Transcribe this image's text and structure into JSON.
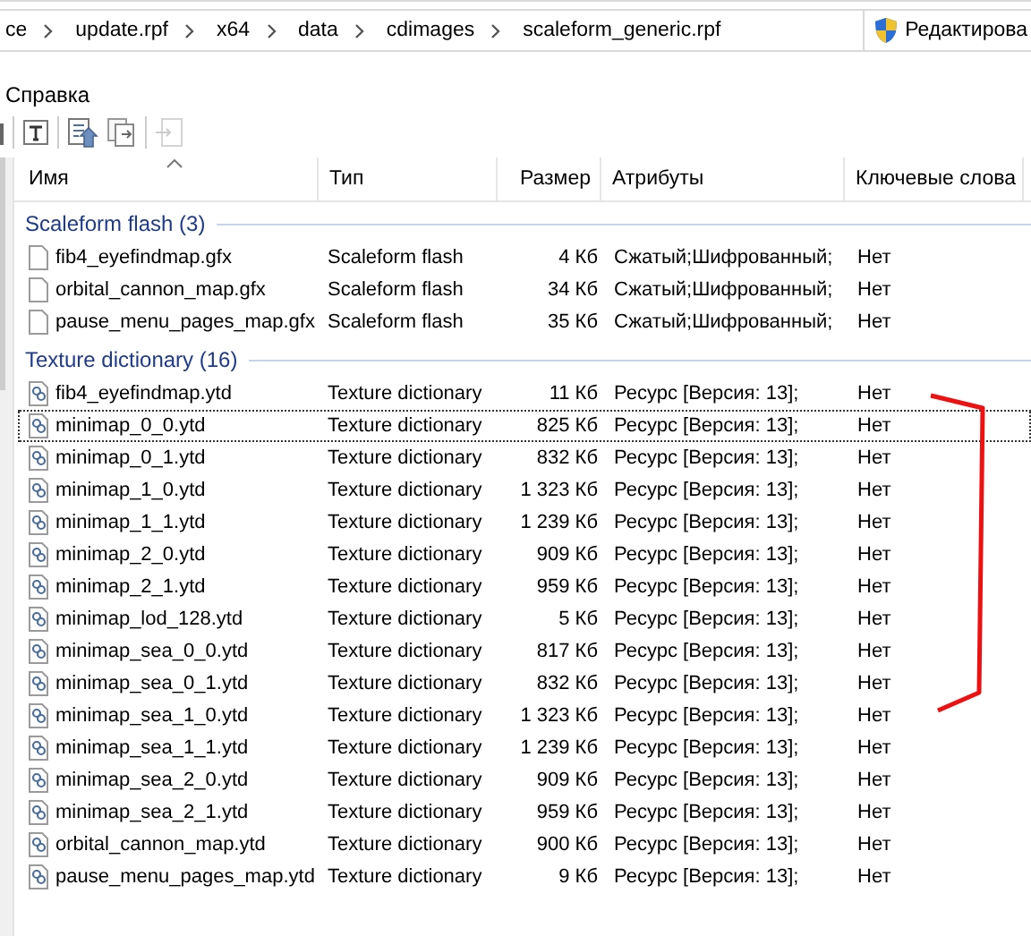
{
  "address_bar": {
    "segments": [
      "ce",
      "update.rpf",
      "x64",
      "data",
      "cdimages",
      "scaleform_generic.rpf"
    ],
    "action_button": "Редактирова"
  },
  "menu_bar": {
    "items": [
      "Справка"
    ]
  },
  "file_list": {
    "columns": [
      {
        "label": "Имя",
        "sorted": true
      },
      {
        "label": "Тип",
        "sorted": false
      },
      {
        "label": "Размер",
        "sorted": false
      },
      {
        "label": "Атрибуты",
        "sorted": false
      },
      {
        "label": "Ключевые слова",
        "sorted": false
      }
    ],
    "groups": [
      {
        "title": "Scaleform flash (3)",
        "kind": "flash",
        "rows": [
          {
            "name": "fib4_eyefindmap.gfx",
            "type": "Scaleform flash",
            "size": "4 Кб",
            "attributes": "Сжатый;Шифрованный;",
            "keywords": "Нет",
            "focused": false
          },
          {
            "name": "orbital_cannon_map.gfx",
            "type": "Scaleform flash",
            "size": "34 Кб",
            "attributes": "Сжатый;Шифрованный;",
            "keywords": "Нет",
            "focused": false
          },
          {
            "name": "pause_menu_pages_map.gfx",
            "type": "Scaleform flash",
            "size": "35 Кб",
            "attributes": "Сжатый;Шифрованный;",
            "keywords": "Нет",
            "focused": false
          }
        ]
      },
      {
        "title": "Texture dictionary (16)",
        "kind": "texture",
        "rows": [
          {
            "name": "fib4_eyefindmap.ytd",
            "type": "Texture dictionary",
            "size": "11 Кб",
            "attributes": "Ресурс [Версия: 13];",
            "keywords": "Нет",
            "focused": false
          },
          {
            "name": "minimap_0_0.ytd",
            "type": "Texture dictionary",
            "size": "825 Кб",
            "attributes": "Ресурс [Версия: 13];",
            "keywords": "Нет",
            "focused": true
          },
          {
            "name": "minimap_0_1.ytd",
            "type": "Texture dictionary",
            "size": "832 Кб",
            "attributes": "Ресурс [Версия: 13];",
            "keywords": "Нет",
            "focused": false
          },
          {
            "name": "minimap_1_0.ytd",
            "type": "Texture dictionary",
            "size": "1 323 Кб",
            "attributes": "Ресурс [Версия: 13];",
            "keywords": "Нет",
            "focused": false
          },
          {
            "name": "minimap_1_1.ytd",
            "type": "Texture dictionary",
            "size": "1 239 Кб",
            "attributes": "Ресурс [Версия: 13];",
            "keywords": "Нет",
            "focused": false
          },
          {
            "name": "minimap_2_0.ytd",
            "type": "Texture dictionary",
            "size": "909 Кб",
            "attributes": "Ресурс [Версия: 13];",
            "keywords": "Нет",
            "focused": false
          },
          {
            "name": "minimap_2_1.ytd",
            "type": "Texture dictionary",
            "size": "959 Кб",
            "attributes": "Ресурс [Версия: 13];",
            "keywords": "Нет",
            "focused": false
          },
          {
            "name": "minimap_lod_128.ytd",
            "type": "Texture dictionary",
            "size": "5 Кб",
            "attributes": "Ресурс [Версия: 13];",
            "keywords": "Нет",
            "focused": false
          },
          {
            "name": "minimap_sea_0_0.ytd",
            "type": "Texture dictionary",
            "size": "817 Кб",
            "attributes": "Ресурс [Версия: 13];",
            "keywords": "Нет",
            "focused": false
          },
          {
            "name": "minimap_sea_0_1.ytd",
            "type": "Texture dictionary",
            "size": "832 Кб",
            "attributes": "Ресурс [Версия: 13];",
            "keywords": "Нет",
            "focused": false
          },
          {
            "name": "minimap_sea_1_0.ytd",
            "type": "Texture dictionary",
            "size": "1 323 Кб",
            "attributes": "Ресурс [Версия: 13];",
            "keywords": "Нет",
            "focused": false
          },
          {
            "name": "minimap_sea_1_1.ytd",
            "type": "Texture dictionary",
            "size": "1 239 Кб",
            "attributes": "Ресурс [Версия: 13];",
            "keywords": "Нет",
            "focused": false
          },
          {
            "name": "minimap_sea_2_0.ytd",
            "type": "Texture dictionary",
            "size": "909 Кб",
            "attributes": "Ресурс [Версия: 13];",
            "keywords": "Нет",
            "focused": false
          },
          {
            "name": "minimap_sea_2_1.ytd",
            "type": "Texture dictionary",
            "size": "959 Кб",
            "attributes": "Ресурс [Версия: 13];",
            "keywords": "Нет",
            "focused": false
          },
          {
            "name": "orbital_cannon_map.ytd",
            "type": "Texture dictionary",
            "size": "900 Кб",
            "attributes": "Ресурс [Версия: 13];",
            "keywords": "Нет",
            "focused": false
          },
          {
            "name": "pause_menu_pages_map.ytd",
            "type": "Texture dictionary",
            "size": "9 Кб",
            "attributes": "Ресурс [Версия: 13];",
            "keywords": "Нет",
            "focused": false
          }
        ]
      }
    ]
  }
}
